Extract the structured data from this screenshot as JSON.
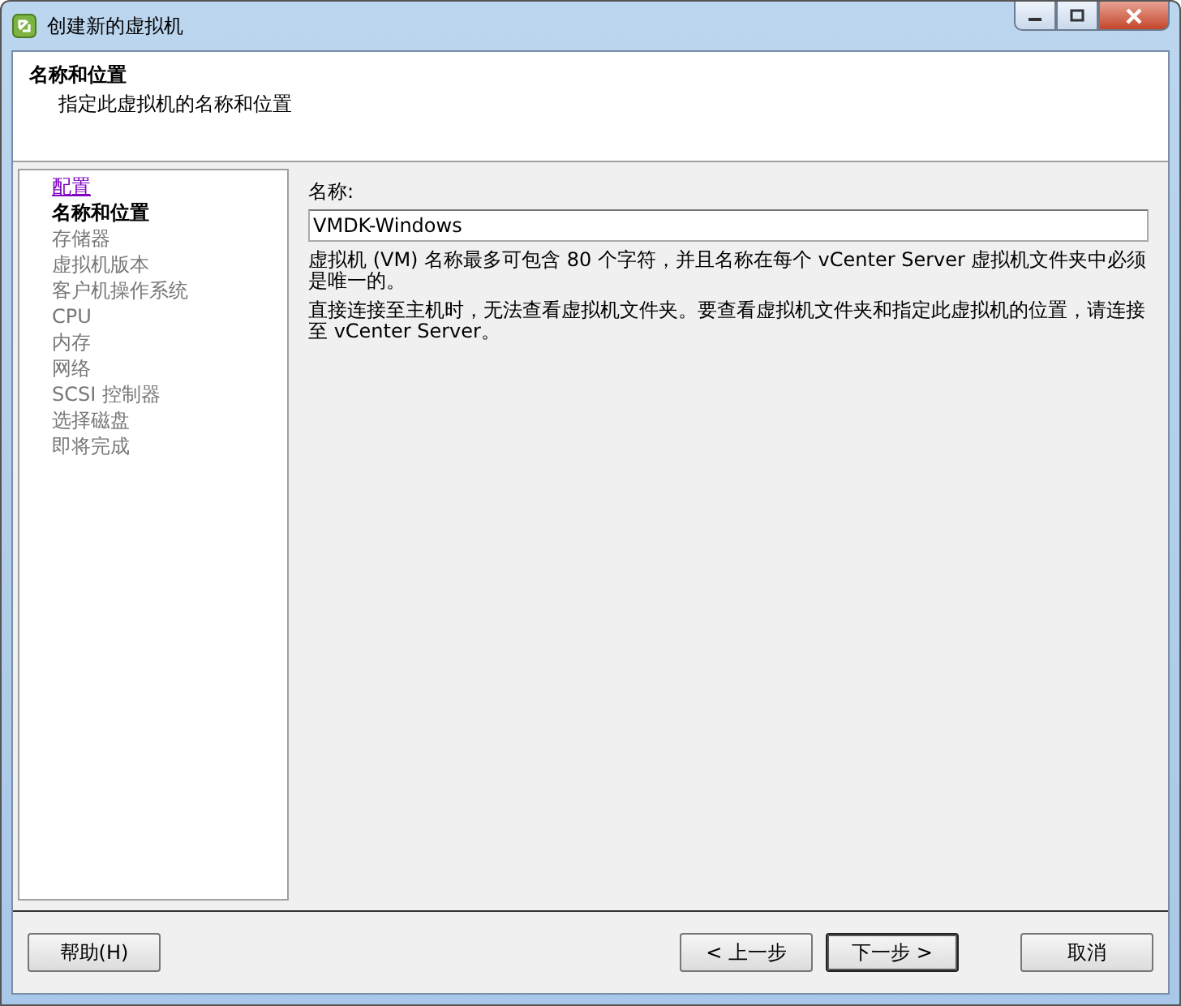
{
  "window": {
    "title": "创建新的虚拟机"
  },
  "header": {
    "title": "名称和位置",
    "subtitle": "指定此虚拟机的名称和位置"
  },
  "steps": [
    {
      "label": "配置",
      "kind": "link"
    },
    {
      "label": "名称和位置",
      "kind": "current"
    },
    {
      "label": "存储器",
      "kind": "pending"
    },
    {
      "label": "虚拟机版本",
      "kind": "pending"
    },
    {
      "label": "客户机操作系统",
      "kind": "pending"
    },
    {
      "label": "CPU",
      "kind": "pending"
    },
    {
      "label": "内存",
      "kind": "pending"
    },
    {
      "label": "网络",
      "kind": "pending"
    },
    {
      "label": "SCSI 控制器",
      "kind": "pending"
    },
    {
      "label": "选择磁盘",
      "kind": "pending"
    },
    {
      "label": "即将完成",
      "kind": "pending"
    }
  ],
  "name_field": {
    "label": "名称:",
    "value": "VMDK-Windows"
  },
  "notes": [
    "虚拟机 (VM) 名称最多可包含 80 个字符，并且名称在每个 vCenter Server 虚拟机文件夹中必须是唯一的。",
    "直接连接至主机时，无法查看虚拟机文件夹。要查看虚拟机文件夹和指定此虚拟机的位置，请连接至 vCenter Server。"
  ],
  "buttons": [
    {
      "label": "帮助(H)",
      "default": false
    },
    {
      "label": "< 上一步",
      "default": false
    },
    {
      "label": "下一步 >",
      "default": true
    },
    {
      "label": "取消",
      "default": false
    }
  ]
}
